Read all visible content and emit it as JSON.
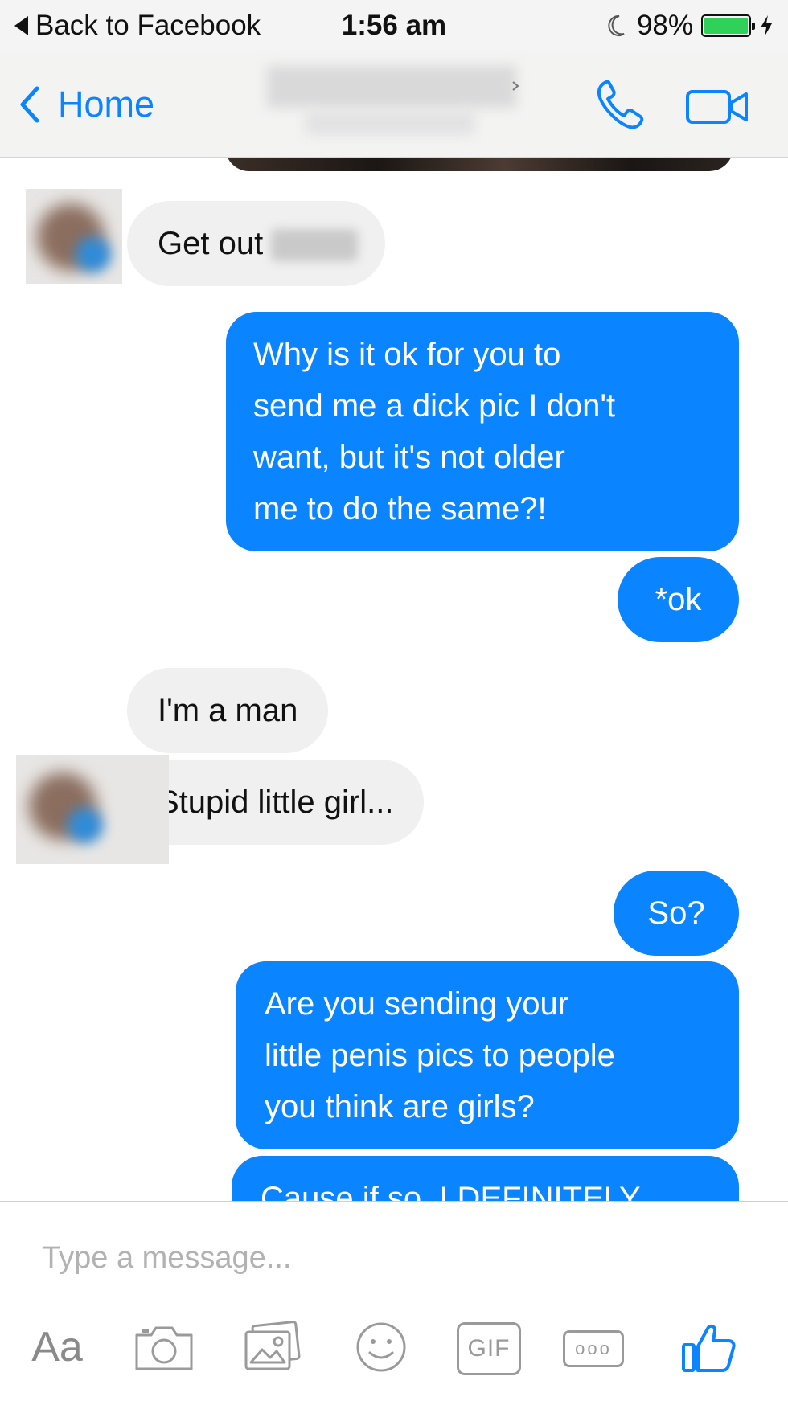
{
  "status_bar": {
    "back_label": "Back to Facebook",
    "time": "1:56 am",
    "battery": "98%",
    "battery_level": 0.98
  },
  "nav": {
    "back_label": "Home",
    "call_icon": "phone-icon",
    "video_icon": "video-camera-icon"
  },
  "messages": [
    {
      "from": "them",
      "text": "Get out"
    },
    {
      "from": "me",
      "lines": [
        "Why is it ok for you to",
        "send me a dick pic I don't",
        "want, but it's not older",
        "me to do the same?!"
      ]
    },
    {
      "from": "me",
      "text": "*ok"
    },
    {
      "from": "them",
      "text": "I'm a man"
    },
    {
      "from": "them",
      "text": "Stupid little girl..."
    },
    {
      "from": "me",
      "text": "So?"
    },
    {
      "from": "me",
      "lines": [
        "Are you sending your",
        "little penis pics to people",
        "you think are girls?"
      ]
    },
    {
      "from": "me",
      "text": "Cause if so, I DEFINITELY"
    }
  ],
  "composer": {
    "placeholder": "Type a message...",
    "text_button": "Aa",
    "gif_button": "GIF",
    "more_button": "ooo",
    "camera_icon": "camera-icon",
    "gallery_icon": "image-gallery-icon",
    "emoji_icon": "smiley-icon",
    "like_icon": "thumbs-up-icon"
  },
  "colors": {
    "accent": "#0b84ff",
    "incoming_bubble": "#f1f0f0",
    "battery_fill": "#2fd158",
    "icon_gray": "#9a9a9a"
  }
}
